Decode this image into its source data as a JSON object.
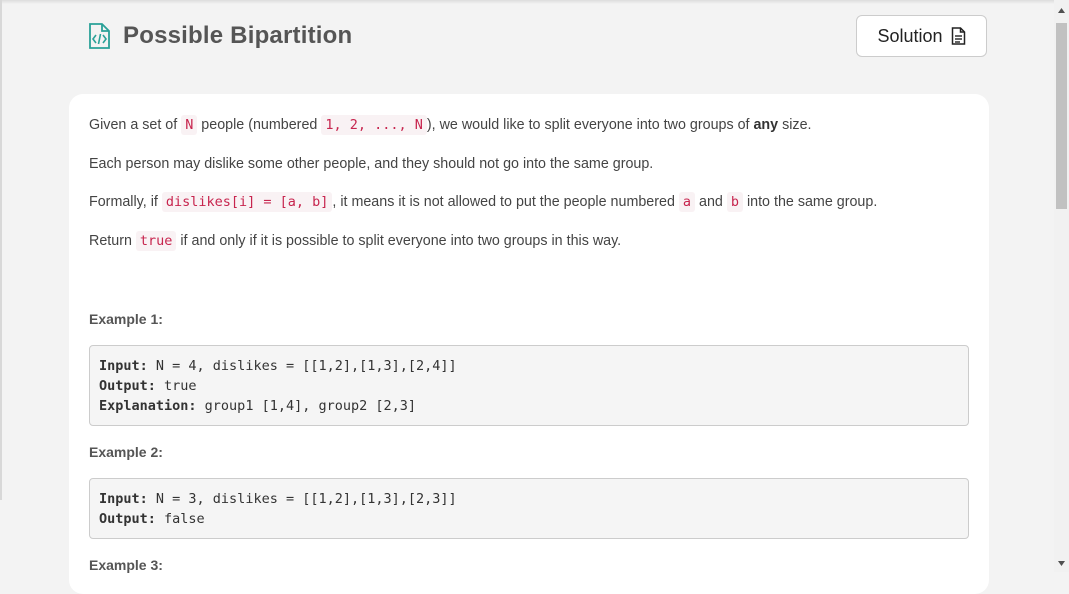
{
  "header": {
    "title": "Possible Bipartition",
    "solution_label": "Solution"
  },
  "description": {
    "p1": {
      "t1": "Given a set of ",
      "c1": "N",
      "t2": " people (numbered ",
      "c2": "1, 2, ..., N",
      "t3": "), we would like to split everyone into two groups of ",
      "b1": "any",
      "t4": " size."
    },
    "p2": "Each person may dislike some other people, and they should not go into the same group.",
    "p3": {
      "t1": "Formally, if ",
      "c1": "dislikes[i] = [a, b]",
      "t2": ", it means it is not allowed to put the people numbered ",
      "c2": "a",
      "t3": " and ",
      "c3": "b",
      "t4": " into the same group."
    },
    "p4": {
      "t1": "Return ",
      "c1": "true",
      "t2": " if and only if it is possible to split everyone into two groups in this way."
    }
  },
  "examples": [
    {
      "heading": "Example 1:",
      "input_label": "Input:",
      "input": " N = 4, dislikes = [[1,2],[1,3],[2,4]]",
      "output_label": "Output:",
      "output": " true",
      "explanation_label": "Explanation:",
      "explanation": " group1 [1,4], group2 [2,3]"
    },
    {
      "heading": "Example 2:",
      "input_label": "Input:",
      "input": " N = 3, dislikes = [[1,2],[1,3],[2,3]]",
      "output_label": "Output:",
      "output": " false"
    },
    {
      "heading": "Example 3:"
    }
  ]
}
